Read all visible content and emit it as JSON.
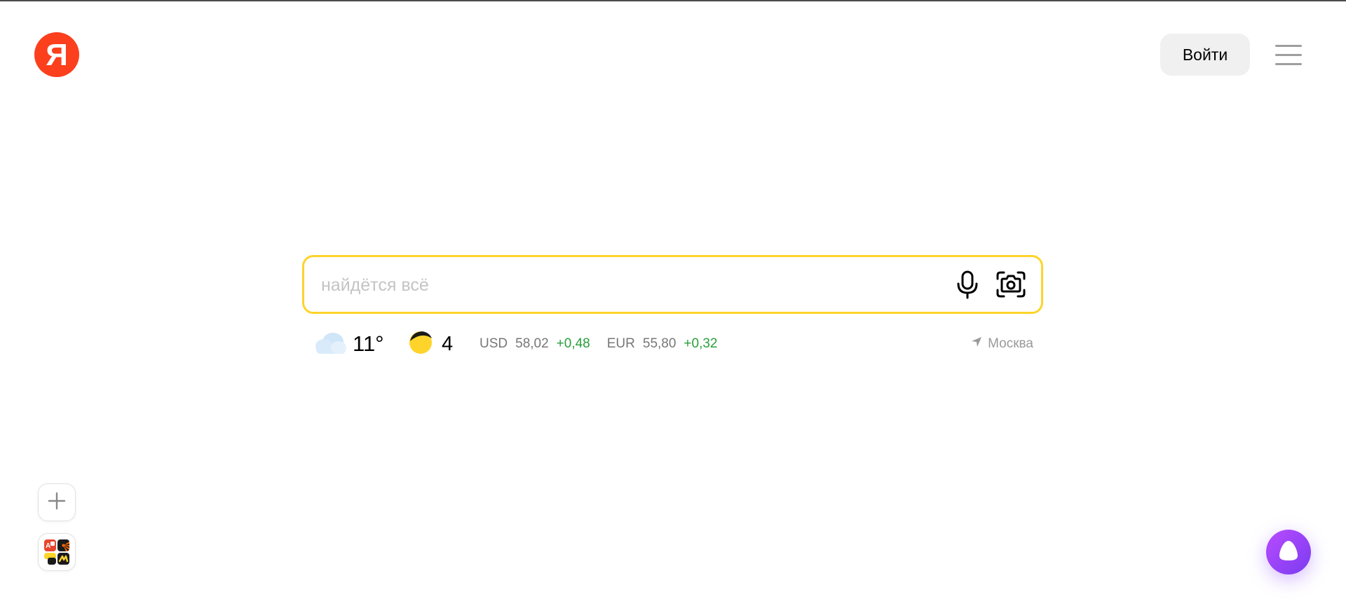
{
  "header": {
    "logo_letter": "Я",
    "login_label": "Войти",
    "menu_icon": "hamburger-menu-icon"
  },
  "search": {
    "placeholder": "найдётся всё",
    "value": "",
    "mic_icon": "microphone-icon",
    "camera_icon": "camera-icon",
    "border_color": "#fed42b"
  },
  "informers": {
    "weather": {
      "icon": "cloud-icon",
      "temperature": "11°"
    },
    "traffic": {
      "icon": "traffic-light-icon",
      "score": "4"
    },
    "rates": [
      {
        "code": "USD",
        "value": "58,02",
        "change": "+0,48"
      },
      {
        "code": "EUR",
        "value": "55,80",
        "change": "+0,32"
      }
    ],
    "location": {
      "icon": "location-arrow-icon",
      "city": "Москва"
    }
  },
  "widgets": {
    "add_icon": "plus-icon",
    "services_icon": "services-grid-icon"
  },
  "alice": {
    "icon": "alice-icon"
  },
  "colors": {
    "brand_red": "#fc3f1d",
    "search_border": "#fed42b",
    "positive_change": "#2a9d3c",
    "alice_purple": "#8c46ff"
  }
}
